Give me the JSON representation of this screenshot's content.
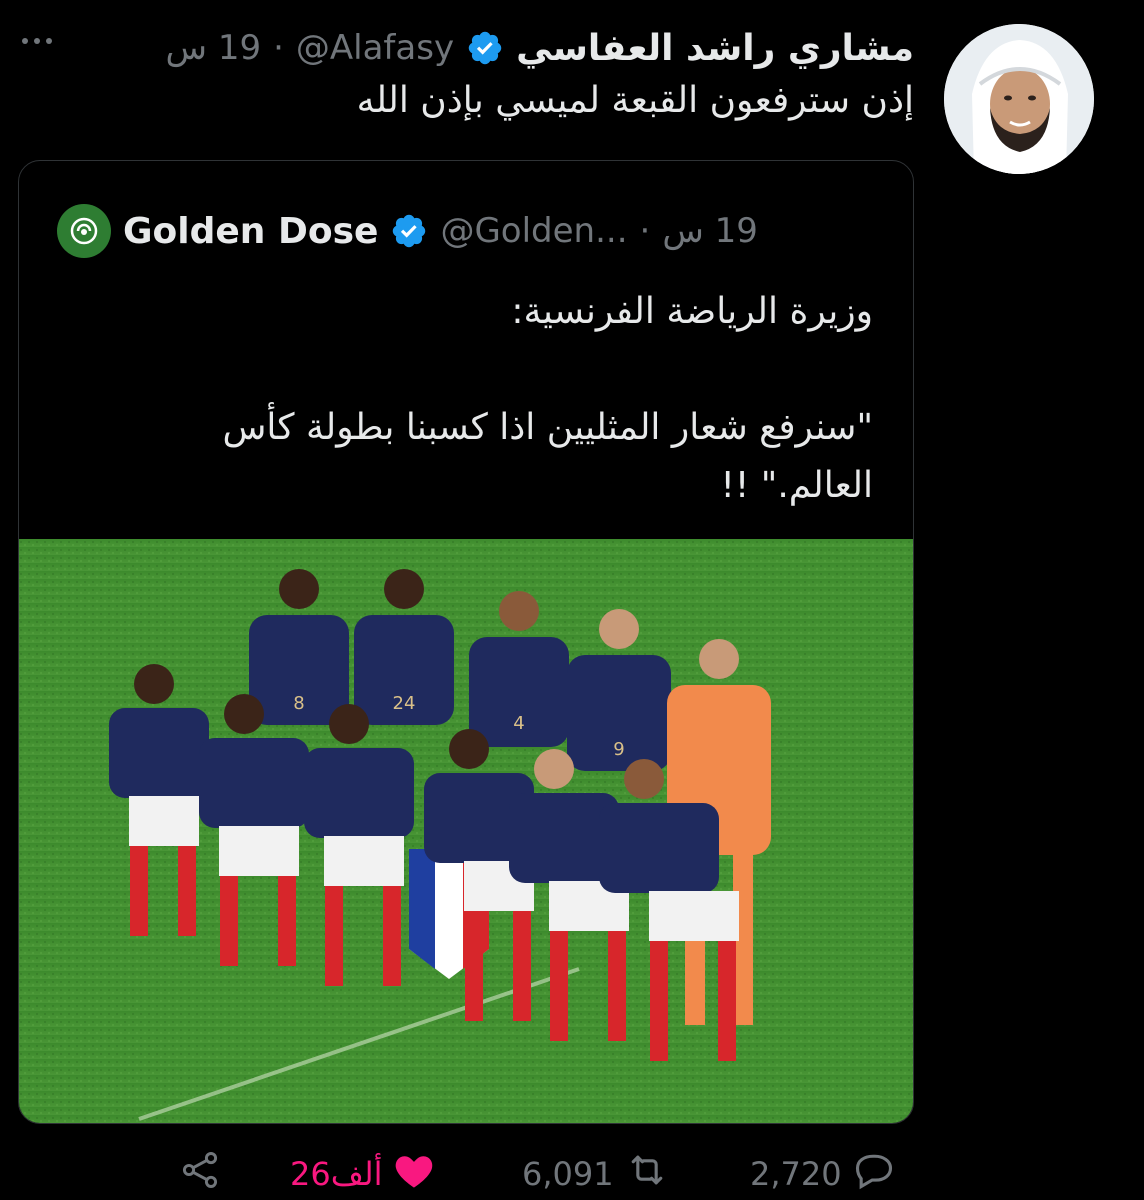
{
  "tweet": {
    "display_name": "مشاري راشد العفاسي",
    "handle": "@Alafasy",
    "separator": "·",
    "time": "19 س",
    "text": "إذن سترفعون القبعة لميسي بإذن الله"
  },
  "quote": {
    "display_name": "Golden Dose",
    "handle": "@Golden...",
    "separator": "·",
    "time": "19 س",
    "lines": [
      "وزيرة الرياضة الفرنسية:",
      "\"سنرفع شعار المثليين اذا كسبنا بطولة كأس",
      "العالم.\" !!"
    ]
  },
  "actions": {
    "replies": "2,720",
    "retweets": "6,091",
    "likes": "26ألف"
  },
  "colors": {
    "background": "#000000",
    "text": "#e7e9ea",
    "muted": "#71767b",
    "verified": "#1d9bf0",
    "like": "#f91880",
    "border": "#2f3336",
    "pitch": "#3f8a2e"
  }
}
